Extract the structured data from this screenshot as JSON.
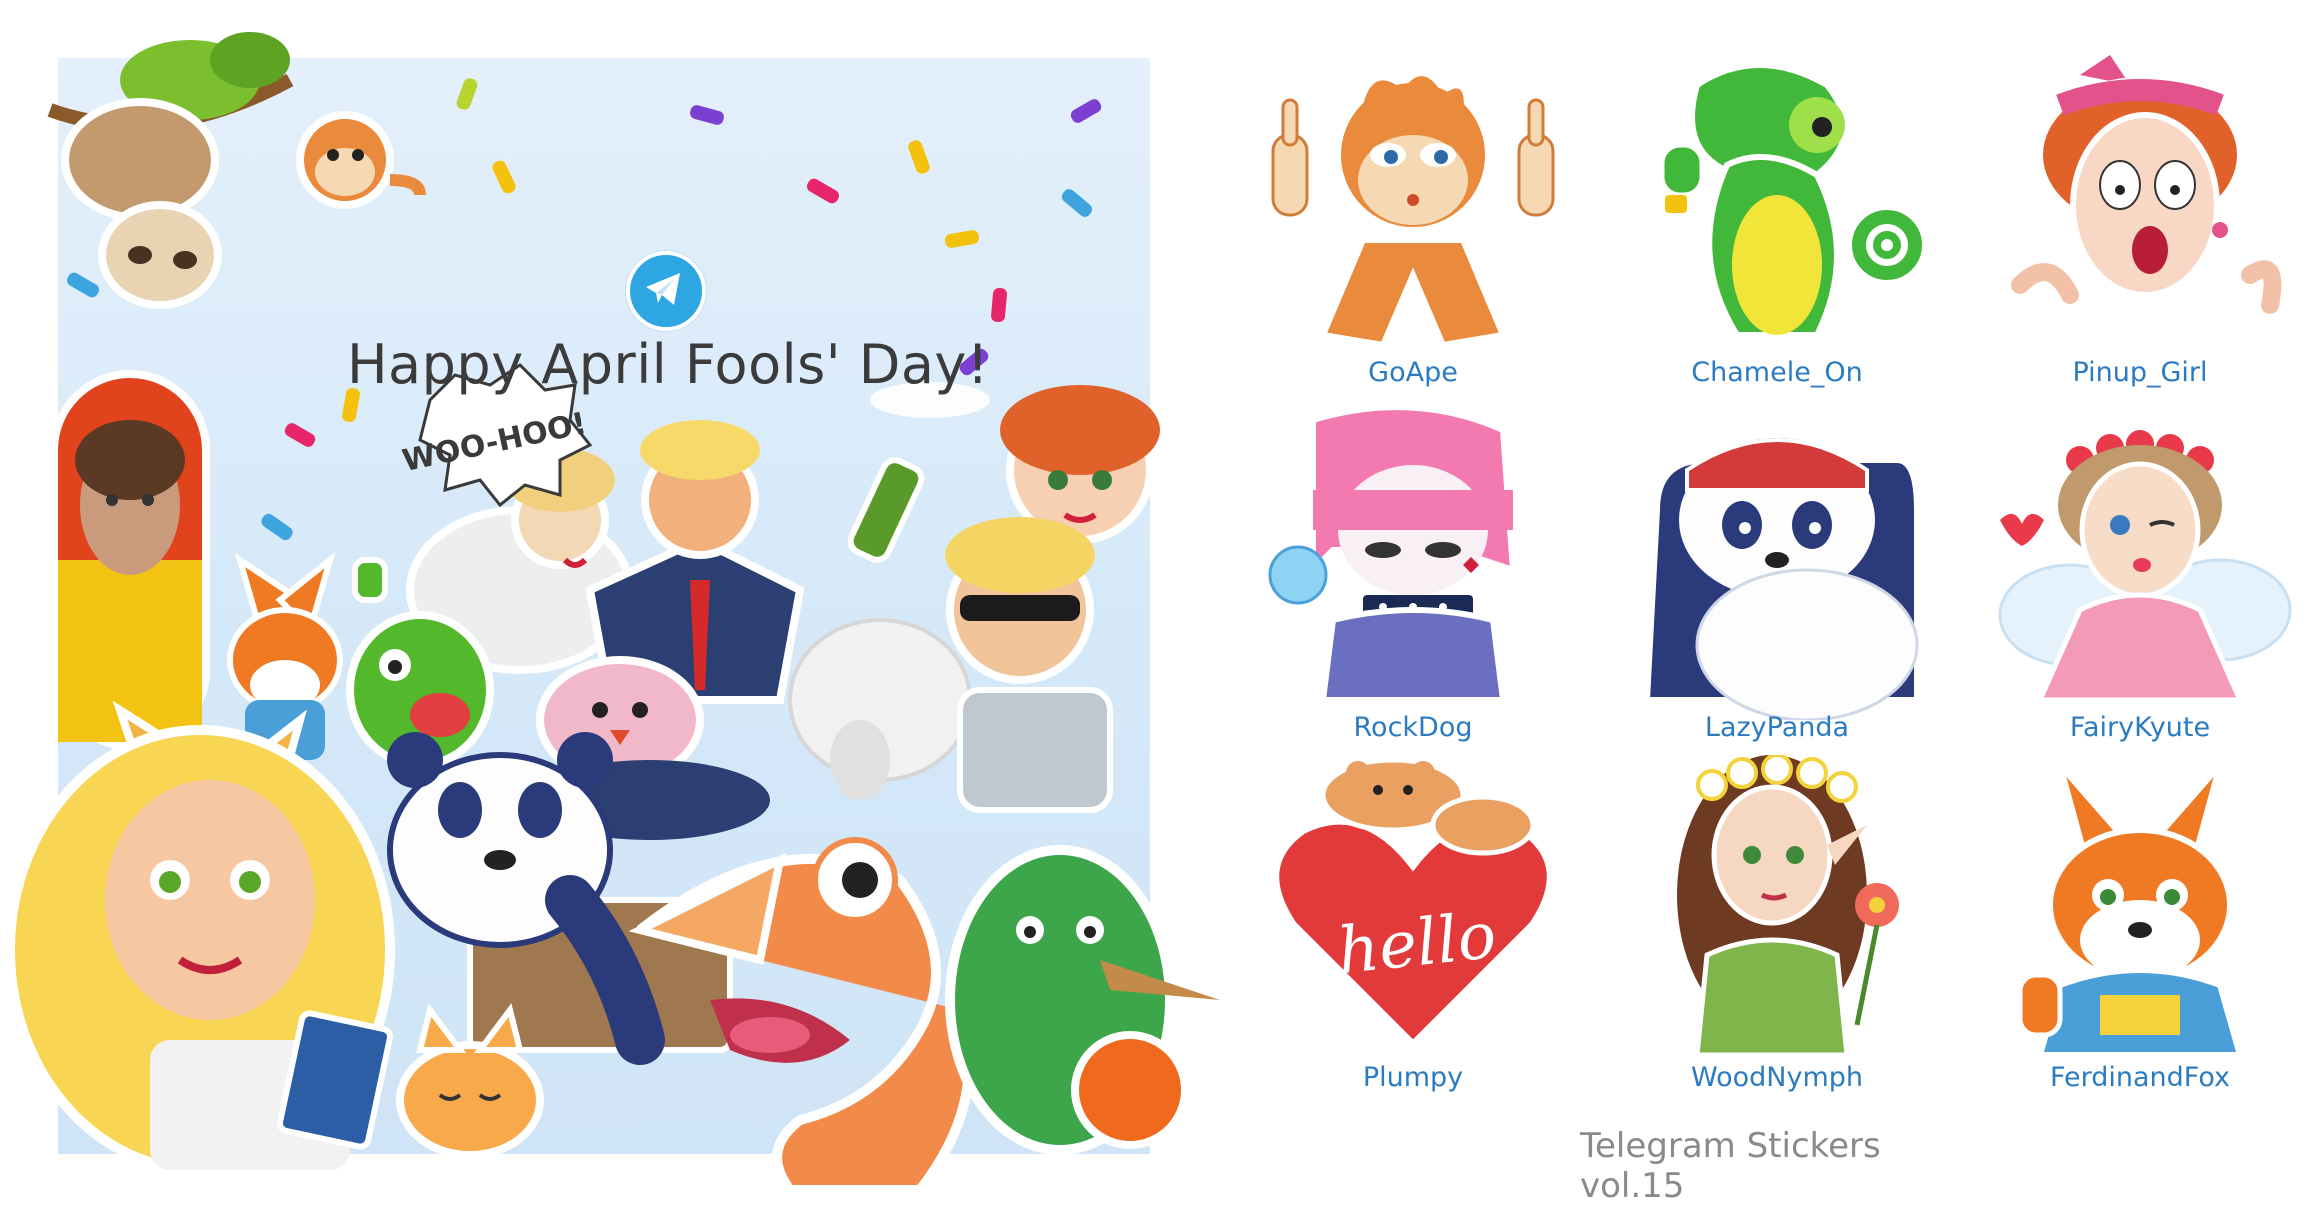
{
  "poster": {
    "title": "Happy April Fools' Day!",
    "badge": "WOO-HOO!",
    "logo_icon": "telegram-paper-plane-icon",
    "background_color": "#d8eaf9",
    "accent_color": "#2ea6e2"
  },
  "stickers": [
    {
      "name": "GoApe"
    },
    {
      "name": "Chamele_On"
    },
    {
      "name": "Pinup_Girl"
    },
    {
      "name": "RockDog"
    },
    {
      "name": "LazyPanda"
    },
    {
      "name": "FairyKyute"
    },
    {
      "name": "Plumpy"
    },
    {
      "name": "WoodNymph"
    },
    {
      "name": "FerdinandFox"
    }
  ],
  "credit": "Telegram Stickers vol.15",
  "colors": {
    "label_blue": "#2b7bc0",
    "credit_gray": "#8a8a8a"
  }
}
